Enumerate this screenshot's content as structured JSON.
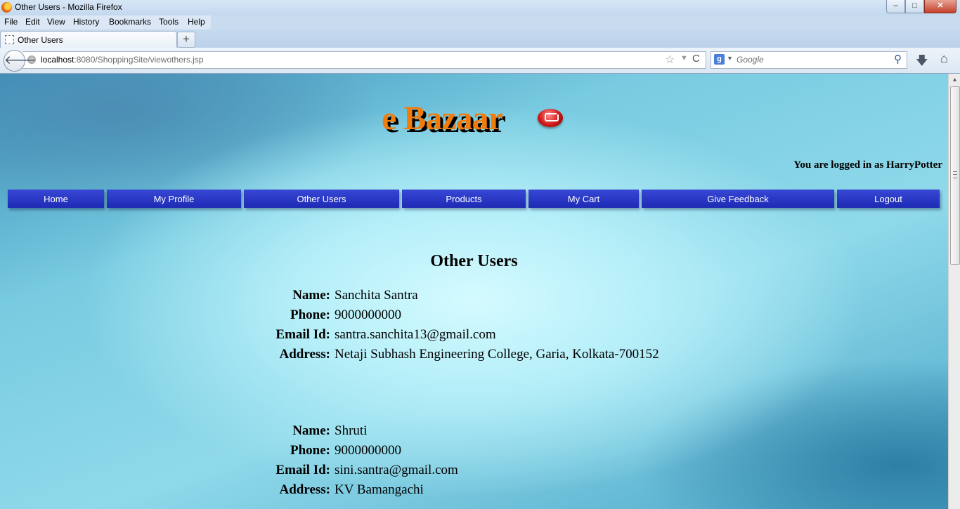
{
  "window": {
    "title": "Other Users - Mozilla Firefox",
    "controls": {
      "minimize": "–",
      "maximize": "□",
      "close": "✕"
    }
  },
  "menu": [
    "File",
    "Edit",
    "View",
    "History",
    "Bookmarks",
    "Tools",
    "Help"
  ],
  "tab": {
    "label": "Other Users",
    "new_tab": "+"
  },
  "urlbar": {
    "host": "localhost",
    "rest": ":8080/ShoppingSite/viewothers.jsp"
  },
  "search": {
    "placeholder": "Google",
    "engine_icon": "g"
  },
  "icons": {
    "back": "🡐",
    "star": "☆",
    "dropdown": "▼",
    "reload": "C",
    "search": "⚲",
    "download": "🡇",
    "home": "⌂"
  },
  "site": {
    "logo": "e Bazaar",
    "login_status": "You are logged in as HarryPotter",
    "nav": [
      "Home",
      "My Profile",
      "Other Users",
      "Products",
      "My Cart",
      "Give Feedback",
      "Logout"
    ],
    "heading": "Other Users",
    "labels": {
      "name": "Name:",
      "phone": "Phone:",
      "email": "Email Id:",
      "address": "Address:"
    },
    "users": [
      {
        "name": "Sanchita Santra",
        "phone": "9000000000",
        "email": "santra.sanchita13@gmail.com",
        "address": "Netaji Subhash Engineering College, Garia, Kolkata-700152"
      },
      {
        "name": "Shruti",
        "phone": "9000000000",
        "email": "sini.santra@gmail.com",
        "address": "KV Bamangachi"
      }
    ]
  },
  "colors": {
    "nav_bg": "#2a36c8",
    "logo": "#f07c0c"
  }
}
